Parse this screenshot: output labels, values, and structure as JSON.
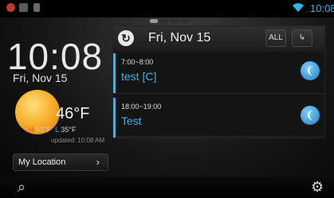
{
  "status_bar": {
    "time": "10:08",
    "icons": [
      "notification-icon",
      "gallery-icon",
      "sd-card-icon",
      "wifi-icon"
    ]
  },
  "clock_widget": {
    "time": "10:08",
    "date": "Fri, Nov 15"
  },
  "weather": {
    "temperature": "46°F",
    "high_label": "H",
    "high": "51°F",
    "low_label": "L",
    "low": "35°F",
    "updated": "updated: 10:08 AM",
    "location_button": "My Location",
    "location_arrow": "›"
  },
  "calendar": {
    "date": "Fri, Nov 15",
    "buttons": {
      "all": "ALL"
    },
    "events": [
      {
        "time": "7:00~8:00",
        "title": "test [C]"
      },
      {
        "time": "18:00~19:00",
        "title": "Test"
      }
    ]
  },
  "colors": {
    "accent": "#33b5e5",
    "high": "#ff4a3a"
  },
  "page_indicator": {
    "total": 4,
    "active": 1
  }
}
